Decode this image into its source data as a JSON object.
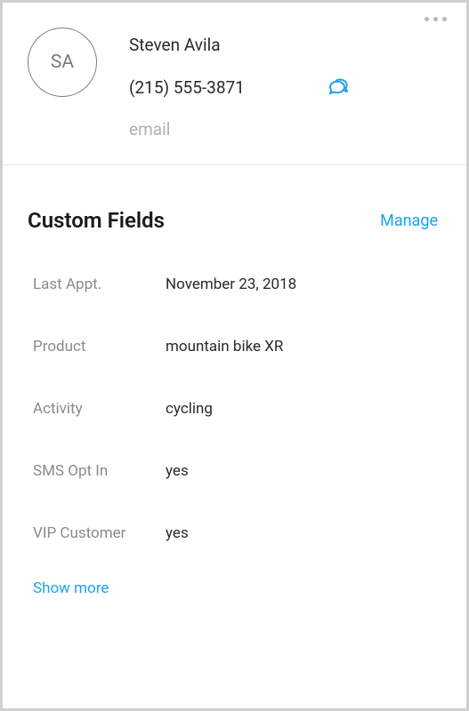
{
  "contact": {
    "initials": "SA",
    "name": "Steven Avila",
    "phone": "(215) 555-3871",
    "email_placeholder": "email"
  },
  "customFields": {
    "title": "Custom Fields",
    "manage_label": "Manage",
    "fields": [
      {
        "label": "Last Appt.",
        "value": "November 23, 2018"
      },
      {
        "label": "Product",
        "value": "mountain bike XR"
      },
      {
        "label": "Activity",
        "value": "cycling"
      },
      {
        "label": "SMS Opt In",
        "value": "yes"
      },
      {
        "label": "VIP Customer",
        "value": "yes"
      }
    ],
    "show_more_label": "Show more"
  }
}
